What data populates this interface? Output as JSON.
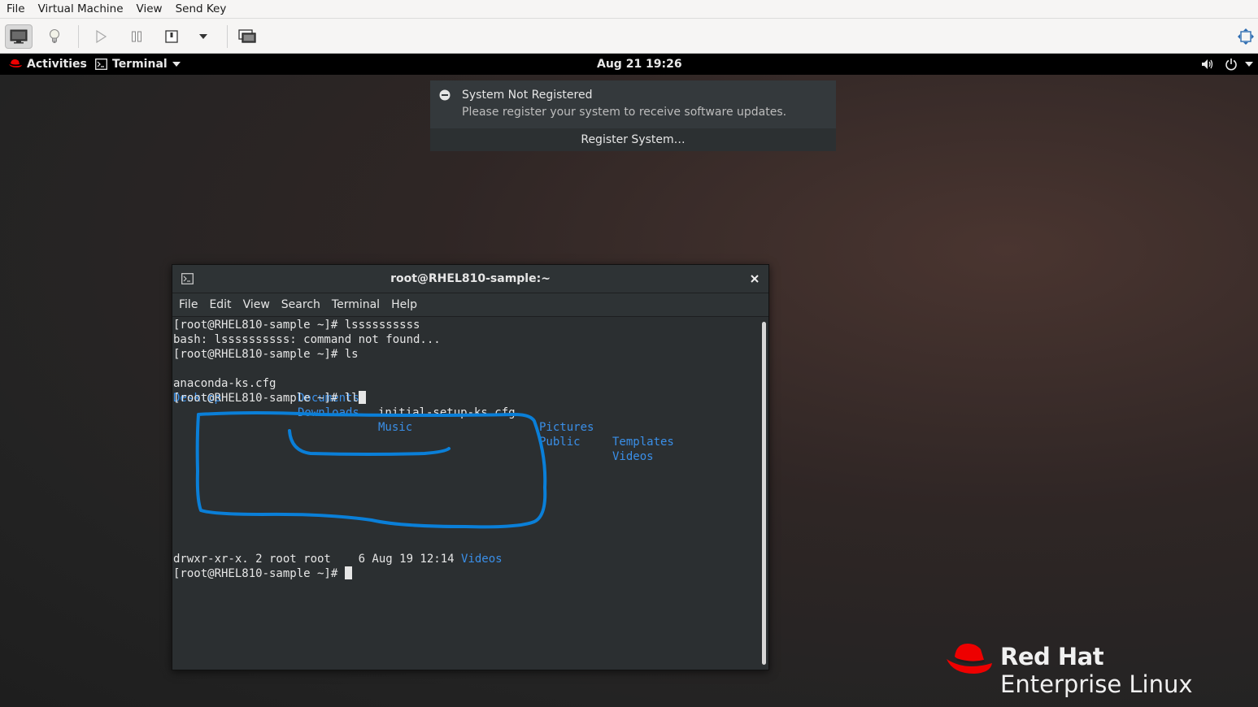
{
  "host": {
    "menu": [
      "File",
      "Virtual Machine",
      "View",
      "Send Key"
    ],
    "toolbar_icons": [
      "monitor-icon",
      "lightbulb-icon",
      "play-icon",
      "pause-icon",
      "power-icon",
      "dropdown-icon",
      "snapshot-icon",
      "fullscreen-icon"
    ]
  },
  "guest": {
    "topbar": {
      "activities": "Activities",
      "app_menu": "Terminal",
      "clock": "Aug 21  19:26"
    },
    "notification": {
      "title": "System Not Registered",
      "message": "Please register your system to receive software updates.",
      "action": "Register System…"
    },
    "terminal": {
      "title": "root@RHEL810-sample:~",
      "menu": [
        "File",
        "Edit",
        "View",
        "Search",
        "Terminal",
        "Help"
      ],
      "lines": {
        "l1": "[root@RHEL810-sample ~]# lssssssssss",
        "l2": "bash: lssssssssss: command not found...",
        "l3": "[root@RHEL810-sample ~]# ls",
        "l4_a": "anaconda-ks.cfg",
        "l4_b": "Documents",
        "l4_c": "initial-setup-ks.cfg",
        "l4_d": "Pictures",
        "l4_e": "Templates",
        "l5_a": "Desktop",
        "l5_b": "Downloads",
        "l5_c": "Music",
        "l5_d": "Public",
        "l5_e": "Videos",
        "l6": "[root@RHEL810-sample ~]# ll",
        "l7_a": "drwxr-xr-x. 2 root root    6 Aug 19 12:14 ",
        "l7_b": "Videos",
        "l8": "[root@RHEL810-sample ~]# "
      }
    },
    "branding": {
      "line1": "Red Hat",
      "line2": "Enterprise Linux"
    },
    "colors": {
      "accent_red": "#ee0000",
      "dir_blue": "#3a8fe8",
      "annotation_blue": "#0a7fd8"
    }
  }
}
